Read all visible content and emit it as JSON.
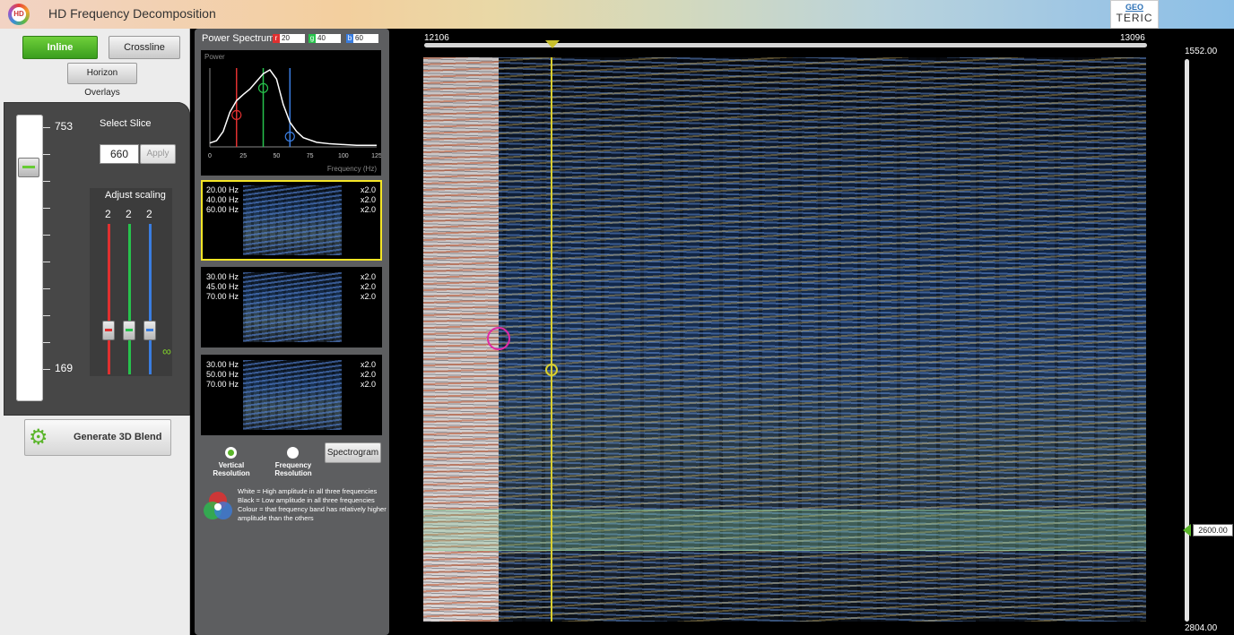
{
  "app": {
    "title": "HD Frequency Decomposition",
    "logo_text": "HD"
  },
  "brand": {
    "line1": "GEO",
    "line2": "TERIC"
  },
  "left": {
    "inline_label": "Inline",
    "crossline_label": "Crossline",
    "horizon_label": "Horizon Overlays",
    "slice_top": "753",
    "slice_bottom": "169",
    "select_slice_label": "Select Slice",
    "slice_value": "660",
    "apply_label": "Apply",
    "adjust_scaling_label": "Adjust scaling",
    "scaling": {
      "red": "2",
      "green": "2",
      "blue": "2"
    },
    "generate_label": "Generate 3D Blend"
  },
  "mid": {
    "power_spectrum_label": "Power Spectrum",
    "chips": {
      "r_label": "r",
      "r_value": "20",
      "g_label": "g",
      "g_value": "40",
      "b_label": "b",
      "b_value": "60"
    },
    "chart": {
      "ylabel": "Power",
      "xlabel": "Frequency (Hz)",
      "x_ticks": [
        "0",
        "25",
        "50",
        "75",
        "100",
        "125"
      ]
    },
    "tiles": [
      {
        "f1": "20.00 Hz",
        "f2": "40.00 Hz",
        "f3": "60.00 Hz",
        "m1": "x2.0",
        "m2": "x2.0",
        "m3": "x2.0"
      },
      {
        "f1": "30.00 Hz",
        "f2": "45.00 Hz",
        "f3": "70.00 Hz",
        "m1": "x2.0",
        "m2": "x2.0",
        "m3": "x2.0"
      },
      {
        "f1": "30.00 Hz",
        "f2": "50.00 Hz",
        "f3": "70.00 Hz",
        "m1": "x2.0",
        "m2": "x2.0",
        "m3": "x2.0"
      }
    ],
    "vertical_resolution": "Vertical Resolution",
    "frequency_resolution": "Frequency Resolution",
    "spectrogram_label": "Spectrogram",
    "legend": [
      "White = High amplitude in all three frequencies",
      "Black = Low amplitude in all three frequencies",
      "Colour = that frequency band has relatively higher amplitude than the others"
    ]
  },
  "view": {
    "trace_start": "12106",
    "trace_end": "13096",
    "depth_top": "1552.00",
    "depth_bottom": "2804.00",
    "depth_marker": "2600.00"
  },
  "chart_data": {
    "type": "line",
    "title": "",
    "xlabel": "Frequency (Hz)",
    "ylabel": "Power",
    "xlim": [
      0,
      125
    ],
    "x": [
      0,
      5,
      10,
      15,
      20,
      25,
      30,
      35,
      40,
      45,
      50,
      55,
      60,
      65,
      70,
      80,
      90,
      100,
      110,
      125
    ],
    "series": [
      {
        "values": [
          0.05,
          0.08,
          0.2,
          0.45,
          0.6,
          0.68,
          0.75,
          0.85,
          0.95,
          1.0,
          0.88,
          0.55,
          0.32,
          0.2,
          0.12,
          0.06,
          0.04,
          0.03,
          0.02,
          0.02
        ]
      }
    ],
    "markers": [
      {
        "x": 20,
        "color": "#e03030"
      },
      {
        "x": 40,
        "color": "#27c24c"
      },
      {
        "x": 60,
        "color": "#3a7de0"
      }
    ],
    "colors": {
      "red": "#e03030",
      "green": "#27c24c",
      "blue": "#3a7de0",
      "curve": "#ffffff"
    }
  }
}
